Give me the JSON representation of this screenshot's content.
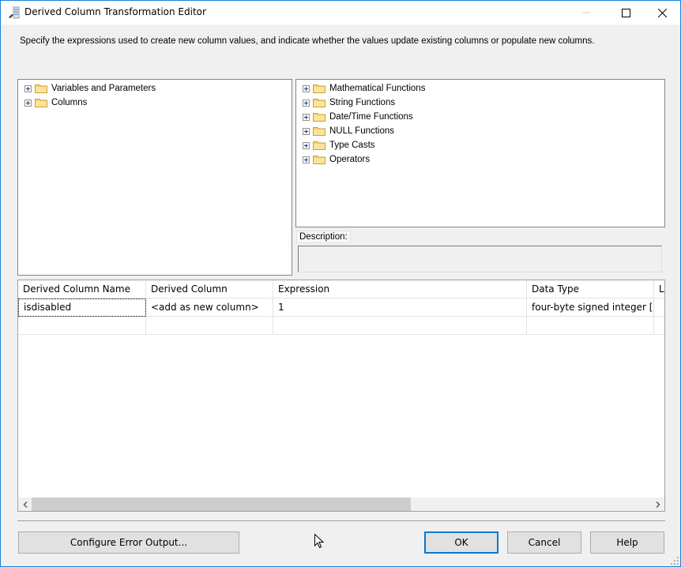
{
  "window": {
    "title": "Derived Column Transformation Editor",
    "controls": {
      "minimize": "minimize-icon",
      "maximize": "maximize-icon",
      "close": "close-icon"
    }
  },
  "instructions": "Specify the expressions used to create new column values, and indicate whether the values update existing columns or populate new columns.",
  "left_tree": {
    "items": [
      {
        "label": "Variables and Parameters",
        "icon": "folder-icon"
      },
      {
        "label": "Columns",
        "icon": "folder-icon"
      }
    ]
  },
  "right_tree": {
    "items": [
      {
        "label": "Mathematical Functions",
        "icon": "folder-icon"
      },
      {
        "label": "String Functions",
        "icon": "folder-icon"
      },
      {
        "label": "Date/Time Functions",
        "icon": "folder-icon"
      },
      {
        "label": "NULL Functions",
        "icon": "folder-icon"
      },
      {
        "label": "Type Casts",
        "icon": "folder-icon"
      },
      {
        "label": "Operators",
        "icon": "folder-icon"
      }
    ]
  },
  "description": {
    "label": "Description:",
    "value": ""
  },
  "grid": {
    "columns": [
      "Derived Column Name",
      "Derived Column",
      "Expression",
      "Data Type",
      "Le"
    ],
    "rows": [
      [
        "isdisabled",
        "<add as new column>",
        "1",
        "four-byte signed integer [...",
        ""
      ],
      [
        "",
        "",
        "",
        "",
        ""
      ]
    ]
  },
  "buttons": {
    "configure_error_output": "Configure Error Output...",
    "ok": "OK",
    "cancel": "Cancel",
    "help": "Help"
  },
  "colors": {
    "accent": "#0078d7",
    "window_border": "#1883d7",
    "background": "#f0f0f0"
  }
}
